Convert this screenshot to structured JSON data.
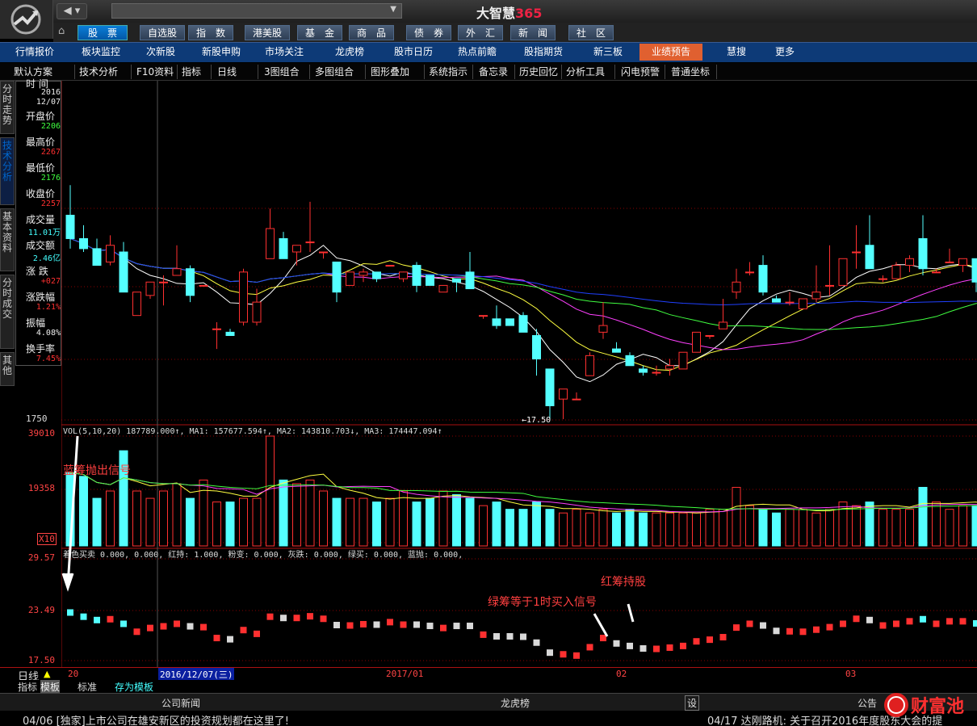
{
  "app": {
    "title": "大智慧",
    "title_num": "365"
  },
  "nav_tabs": [
    {
      "label": "股　票",
      "active": true
    },
    {
      "label": "自选股"
    },
    {
      "label": "指　数"
    },
    {
      "label": "港美股"
    },
    {
      "label": "基　金"
    },
    {
      "label": "商　品"
    },
    {
      "label": "债　券"
    },
    {
      "label": "外　汇"
    },
    {
      "label": "新　闻"
    },
    {
      "label": "社　区"
    }
  ],
  "sub_tabs": [
    {
      "label": "行情报价"
    },
    {
      "label": "板块监控"
    },
    {
      "label": "次新股"
    },
    {
      "label": "新股申购"
    },
    {
      "label": "市场关注"
    },
    {
      "label": "龙虎榜"
    },
    {
      "label": "股市日历"
    },
    {
      "label": "热点前瞻"
    },
    {
      "label": "股指期货"
    },
    {
      "label": "新三板"
    },
    {
      "label": "业绩预告",
      "active": true
    },
    {
      "label": "慧搜"
    },
    {
      "label": "更多"
    }
  ],
  "toolbar": [
    "默认方案",
    "技术分析",
    "F10资料",
    "指标",
    "日线",
    "3图组合",
    "多图组合",
    "图形叠加",
    "系统指示",
    "备忘录",
    "历史回忆",
    "分析工具",
    "闪电预警",
    "普通坐标"
  ],
  "left_tabs": [
    "分时走势",
    "技术分析",
    "基本资料",
    "分时成交",
    "其他"
  ],
  "info_panel": {
    "items": [
      {
        "label": "时 间",
        "value": "2016"
      },
      {
        "label": "",
        "value": "12/07"
      },
      {
        "label": "开盘价",
        "value": "2206"
      },
      {
        "label": "最高价",
        "value": "2267"
      },
      {
        "label": "最低价",
        "value": "2176"
      },
      {
        "label": "收盘价",
        "value": "2257"
      },
      {
        "label": "成交量",
        "value": "11.01万"
      },
      {
        "label": "成交额",
        "value": "2.46亿"
      },
      {
        "label": "涨 跌",
        "value": "+027"
      },
      {
        "label": "涨跌幅",
        "value": "1.21%"
      },
      {
        "label": "振幅",
        "value": "4.08%"
      },
      {
        "label": "换手率",
        "value": "7.45%"
      }
    ]
  },
  "price_panel": {
    "low_label": "1750",
    "low_marker": "←17.50"
  },
  "volume_panel": {
    "y_labels": [
      "39010",
      "19358",
      "X10"
    ],
    "header": "VOL(5,10,20)  187789.000↑, MA1: 157677.594↑, MA2: 143810.703↓, MA3: 174447.094↑"
  },
  "signal_panel": {
    "y_labels": [
      "29.57",
      "23.49",
      "17.50"
    ],
    "header": "着色买卖 0.000, 0.000, 红持: 1.000, 粉变: 0.000, 灰跌: 0.000, 绿买: 0.000, 蓝抛: 0.000,"
  },
  "annotations": {
    "blue": "蓝筹抛出信号",
    "green": "绿筹等于1时买入信号",
    "red": "红筹持股"
  },
  "time_axis": {
    "period": "日线",
    "cursor_date": "2016/12/07(三)",
    "labels": [
      "20",
      "2017/01",
      "02",
      "03"
    ]
  },
  "template_tabs": [
    "指标",
    "模板",
    "标准",
    "存为模板"
  ],
  "bottom_bar": {
    "left": "公司新闻",
    "mid": "龙虎榜",
    "settings": "设",
    "right": "公告"
  },
  "news": {
    "left": "04/06 [独家]上市公司在雄安新区的投资规划都在这里了!",
    "right": "04/17 达刚路机: 关于召开2016年度股东大会的提"
  },
  "watermark": "财富池",
  "colors": {
    "up": "#ff3030",
    "down": "#54ffff",
    "ma_white": "#ffffff",
    "ma_yellow": "#ffff40",
    "ma_magenta": "#ff40ff",
    "ma_green": "#40ff40",
    "ma_blue": "#2040ff",
    "grid": "#8a0000"
  },
  "chart_data": {
    "type": "candlestick",
    "candles": [
      [
        23.6,
        24.5,
        22.6,
        22.9
      ],
      [
        22.9,
        23.3,
        22.5,
        22.6
      ],
      [
        22.6,
        22.9,
        22.1,
        22.1
      ],
      [
        22.2,
        23.0,
        22.1,
        22.7
      ],
      [
        22.5,
        22.8,
        21.3,
        21.3
      ],
      [
        20.6,
        21.3,
        20.6,
        21.3
      ],
      [
        21.2,
        21.6,
        21.1,
        21.6
      ],
      [
        21.6,
        21.8,
        20.9,
        21.6
      ],
      [
        21.8,
        22.7,
        21.8,
        22.0
      ],
      [
        22.0,
        22.1,
        21.0,
        21.2
      ],
      [
        21.5,
        21.5,
        21.5,
        21.5
      ],
      [
        20.2,
        20.4,
        19.6,
        20.2
      ],
      [
        20.1,
        20.2,
        20.0,
        20.0
      ],
      [
        20.4,
        22.0,
        20.3,
        21.9
      ],
      [
        20.4,
        21.4,
        20.3,
        21.0
      ],
      [
        22.3,
        23.8,
        22.5,
        23.2
      ],
      [
        22.9,
        23.1,
        22.3,
        22.3
      ],
      [
        22.5,
        22.7,
        22.1,
        22.7
      ],
      [
        22.8,
        24.0,
        22.5,
        22.8
      ],
      [
        22.5,
        22.5,
        22.3,
        22.5
      ],
      [
        22.2,
        22.2,
        21.0,
        21.3
      ],
      [
        21.5,
        21.9,
        21.5,
        21.9
      ],
      [
        21.8,
        22.0,
        21.6,
        21.9
      ],
      [
        21.9,
        21.9,
        21.6,
        21.7
      ],
      [
        22.1,
        22.1,
        22.1,
        22.1
      ],
      [
        21.7,
        21.9,
        21.6,
        21.9
      ],
      [
        22.1,
        22.2,
        21.3,
        21.5
      ],
      [
        21.8,
        21.8,
        21.5,
        21.5
      ],
      [
        21.3,
        21.5,
        21.3,
        21.5
      ],
      [
        21.7,
        21.7,
        21.3,
        21.6
      ],
      [
        21.9,
        22.5,
        21.4,
        21.4
      ],
      [
        20.6,
        20.6,
        20.5,
        20.6
      ],
      [
        20.5,
        20.9,
        20.2,
        20.3
      ],
      [
        20.5,
        20.5,
        20.3,
        20.3
      ],
      [
        20.6,
        20.7,
        20.1,
        20.1
      ],
      [
        20.0,
        20.2,
        18.8,
        19.3
      ],
      [
        19.0,
        19.0,
        17.5,
        17.9
      ],
      [
        18.1,
        18.4,
        17.5,
        18.4
      ],
      [
        18.1,
        18.3,
        18.1,
        18.1
      ],
      [
        18.8,
        19.5,
        18.8,
        19.4
      ],
      [
        20.1,
        21.0,
        19.9,
        20.3
      ],
      [
        19.6,
        19.8,
        19.5,
        19.5
      ],
      [
        19.4,
        19.5,
        19.1,
        19.1
      ],
      [
        19.0,
        19.1,
        18.8,
        18.9
      ],
      [
        18.9,
        19.1,
        18.8,
        18.9
      ],
      [
        19.0,
        19.3,
        18.8,
        19.1
      ],
      [
        19.0,
        19.5,
        19.0,
        19.5
      ],
      [
        19.5,
        20.1,
        19.5,
        20.1
      ],
      [
        20.0,
        20.0,
        19.9,
        20.0
      ],
      [
        20.2,
        21.1,
        20.2,
        20.4
      ],
      [
        21.3,
        22.0,
        21.1,
        21.6
      ],
      [
        21.9,
        22.2,
        21.8,
        21.9
      ],
      [
        22.1,
        22.4,
        21.2,
        21.3
      ],
      [
        21.1,
        21.2,
        21.0,
        21.0
      ],
      [
        21.0,
        21.3,
        20.9,
        21.0
      ],
      [
        20.8,
        21.1,
        20.8,
        21.1
      ],
      [
        21.1,
        22.1,
        21.0,
        21.3
      ],
      [
        21.5,
        22.7,
        21.2,
        21.5
      ],
      [
        21.5,
        22.3,
        21.5,
        22.3
      ],
      [
        22.5,
        23.3,
        22.0,
        22.5
      ],
      [
        22.7,
        23.6,
        22.2,
        22.0
      ],
      [
        21.7,
        21.8,
        21.6,
        21.7
      ],
      [
        21.7,
        22.2,
        21.7,
        22.1
      ],
      [
        22.1,
        22.4,
        21.9,
        22.3
      ],
      [
        22.9,
        23.6,
        21.8,
        22.0
      ],
      [
        21.9,
        22.0,
        21.9,
        21.9
      ],
      [
        22.2,
        22.6,
        22.2,
        22.2
      ],
      [
        22.1,
        22.3,
        21.9,
        22.3
      ],
      [
        22.3,
        22.3,
        21.3,
        21.6
      ],
      [
        21.6,
        21.7,
        21.3,
        21.7
      ],
      [
        21.6,
        21.7,
        21.6,
        21.6
      ],
      [
        21.5,
        21.7,
        21.3,
        21.4
      ]
    ],
    "volume": [
      20,
      19,
      13,
      15,
      26,
      15,
      13,
      15,
      17,
      13,
      18,
      12,
      12,
      13,
      13,
      30,
      18,
      17,
      18,
      15,
      13,
      13,
      13,
      12,
      13,
      15,
      12,
      13,
      15,
      14,
      13,
      11,
      12,
      10,
      10,
      12,
      10,
      9,
      10,
      9,
      10,
      9,
      10,
      9,
      9,
      9,
      9,
      9,
      10,
      10,
      16,
      11,
      10,
      9,
      10,
      10,
      9,
      10,
      12,
      11,
      12,
      10,
      10,
      10,
      16,
      12,
      10,
      11,
      11,
      9,
      9,
      8
    ],
    "volume_max": 39010
  }
}
